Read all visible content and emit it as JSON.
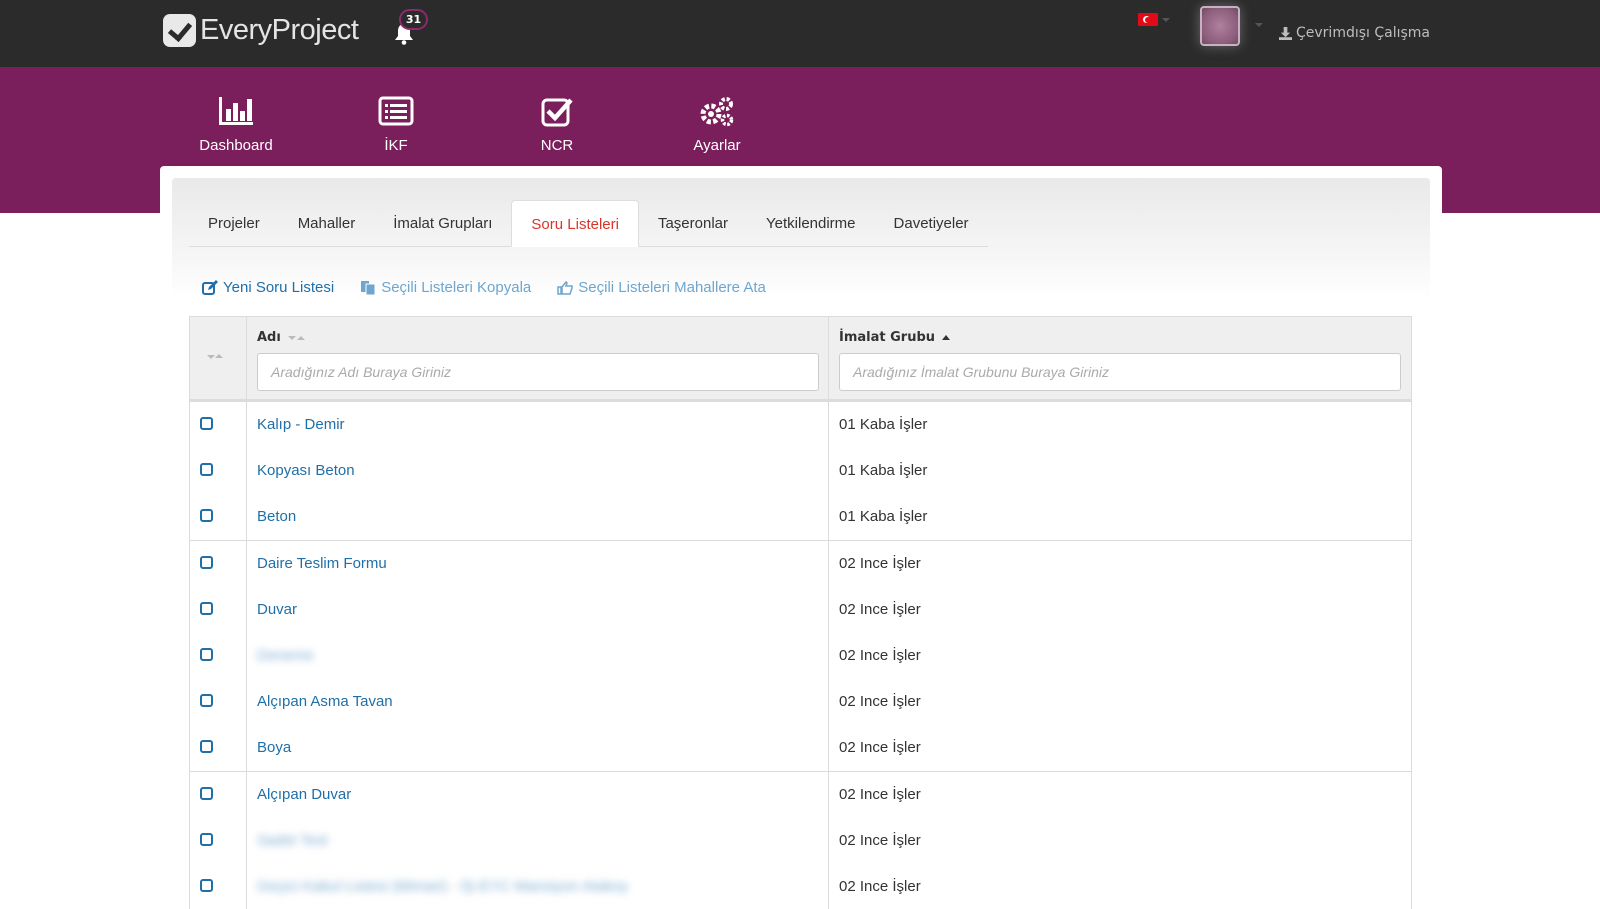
{
  "header": {
    "logo_text": "EveryProject",
    "notification_count": "31",
    "offline_label": "Çevrimdışı Çalışma"
  },
  "main_nav": [
    {
      "label": "Dashboard",
      "icon": "bar-chart-icon"
    },
    {
      "label": "İKF",
      "icon": "list-icon"
    },
    {
      "label": "NCR",
      "icon": "checkbox-icon"
    },
    {
      "label": "Ayarlar",
      "icon": "gears-icon"
    }
  ],
  "tabs": [
    {
      "label": "Projeler"
    },
    {
      "label": "Mahaller"
    },
    {
      "label": "İmalat Grupları"
    },
    {
      "label": "Soru Listeleri",
      "active": true
    },
    {
      "label": "Taşeronlar"
    },
    {
      "label": "Yetkilendirme"
    },
    {
      "label": "Davetiyeler"
    }
  ],
  "actions": {
    "new_list": "Yeni Soru Listesi",
    "copy_selected": "Seçili Listeleri Kopyala",
    "assign_selected": "Seçili Listeleri Mahallere Ata"
  },
  "table": {
    "col_name": "Adı",
    "col_group": "İmalat Grubu",
    "filter_name_placeholder": "Aradığınız Adı Buraya Giriniz",
    "filter_group_placeholder": "Aradığınız İmalat Grubunu Buraya Giriniz",
    "rows": [
      {
        "name": "Kalıp - Demir",
        "group": "01 Kaba İşler",
        "blurred": false
      },
      {
        "name": "Kopyası Beton",
        "group": "01 Kaba İşler",
        "blurred": false
      },
      {
        "name": "Beton",
        "group": "01 Kaba İşler",
        "blurred": false
      },
      {
        "name": "Daire Teslim Formu",
        "group": "02 Ince İşler",
        "blurred": false
      },
      {
        "name": "Duvar",
        "group": "02 Ince İşler",
        "blurred": false
      },
      {
        "name": "Deneme",
        "group": "02 Ince İşler",
        "blurred": true
      },
      {
        "name": "Alçıpan Asma Tavan",
        "group": "02 Ince İşler",
        "blurred": false
      },
      {
        "name": "Boya",
        "group": "02 Ince İşler",
        "blurred": false
      },
      {
        "name": "Alçıpan Duvar",
        "group": "02 Ince İşler",
        "blurred": false
      },
      {
        "name": "Sadet Test",
        "group": "02 Ince İşler",
        "blurred": true
      },
      {
        "name": "Geçici Kabul Listesi (Mimari) - İŞ-EYC Mansiyon Atakoy",
        "group": "02 Ince İşler",
        "blurred": true
      }
    ]
  },
  "colors": {
    "topbar": "#2b2b2b",
    "brand_purple": "#7b1f5c",
    "link_blue": "#1f6fa8",
    "active_tab_red": "#d9342b"
  }
}
